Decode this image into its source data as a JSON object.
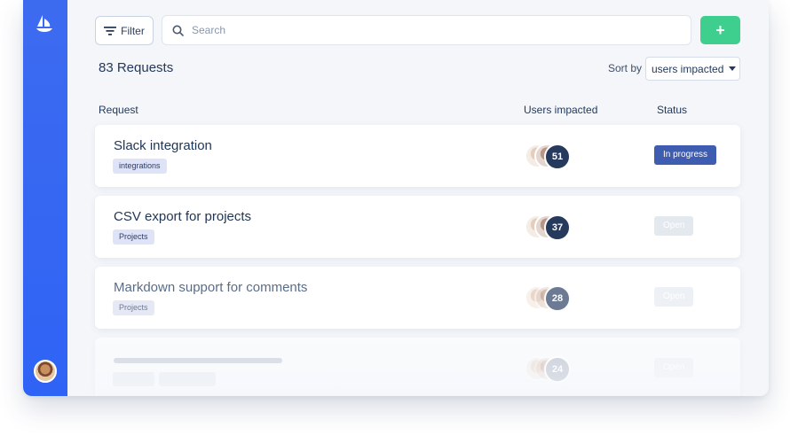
{
  "toolbar": {
    "filter_label": "Filter",
    "search_placeholder": "Search",
    "add_label": "+"
  },
  "summary": {
    "request_count": "83 Requests",
    "sort_label": "Sort by",
    "sort_value": "users impacted"
  },
  "columns": {
    "request": "Request",
    "users": "Users impacted",
    "status": "Status"
  },
  "rows": [
    {
      "title": "Slack integration",
      "tag": "integrations",
      "users": "51",
      "status": "In progress"
    },
    {
      "title": "CSV export for projects",
      "tag": "Projects",
      "users": "37",
      "status": "Open"
    },
    {
      "title": "Markdown support for comments",
      "tag": "Projects",
      "users": "28",
      "status": "Open"
    },
    {
      "users": "24",
      "status": "Open"
    }
  ],
  "icons": {
    "logo": "sailboat-logo-icon",
    "filter": "filter-lines-icon",
    "search": "search-icon",
    "sort": "caret-down-icon"
  },
  "colors": {
    "sidebar": "#2f63f5",
    "add_button": "#3ecf8e",
    "status_in_progress": "#3f5db0",
    "status_open": "#e4e8ef"
  }
}
